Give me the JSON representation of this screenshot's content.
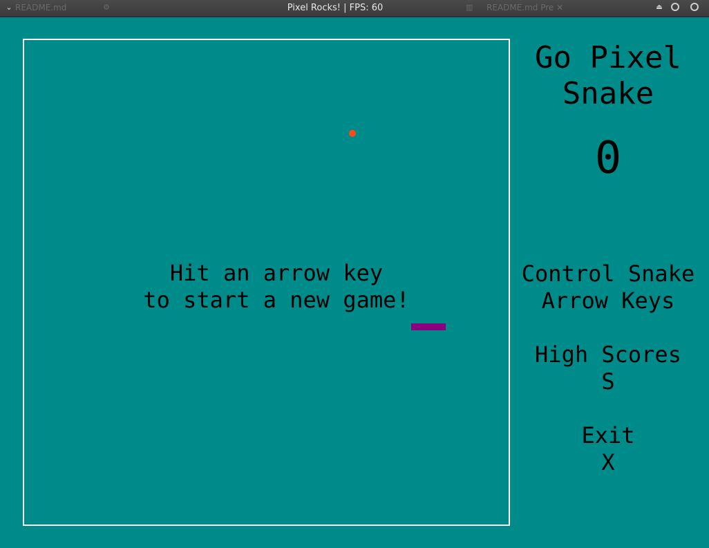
{
  "window": {
    "title": "Pixel Rocks! | FPS: 60",
    "ghost_left_tab": "README.md",
    "ghost_right_tab": "README.md Pre",
    "ghost_right_close": "✕",
    "menu_icon": "chevron-down-icon"
  },
  "colors": {
    "background": "#008b8b",
    "border": "#ffffff",
    "food": "#ff4a1a",
    "snake": "#8a007f",
    "text": "#000000"
  },
  "game": {
    "start_line1": "Hit an arrow key",
    "start_line2": "to start a new game!"
  },
  "sidebar": {
    "title_line1": "Go Pixel",
    "title_line2": "Snake",
    "score": "0",
    "control_label": "Control Snake",
    "control_value": "Arrow Keys",
    "high_scores_label": "High Scores",
    "high_scores_key": "S",
    "exit_label": "Exit",
    "exit_key": "X"
  }
}
